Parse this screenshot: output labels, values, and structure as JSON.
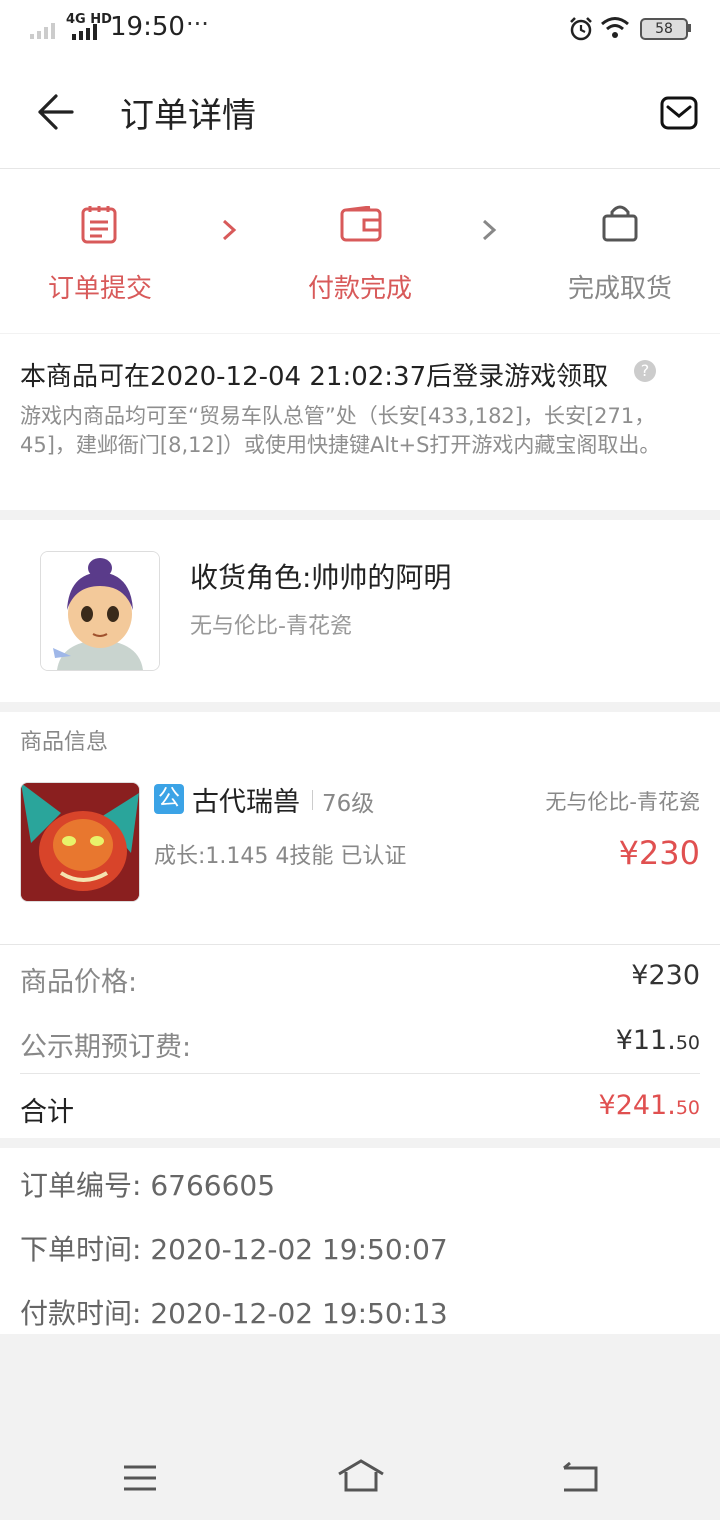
{
  "status_bar": {
    "network": "4G HD",
    "time": "19:50",
    "more": "···",
    "battery": "58"
  },
  "header": {
    "title": "订单详情"
  },
  "steps": [
    {
      "label": "订单提交",
      "color": "#d85a5a"
    },
    {
      "label": "付款完成",
      "color": "#d85a5a"
    },
    {
      "label": "完成取货",
      "color": "#888888"
    }
  ],
  "notice": {
    "title": "本商品可在2020-12-04 21:02:37后登录游戏领取",
    "help": "?",
    "description": "游戏内商品均可至“贸易车队总管”处（长安[433,182]，长安[271，45]，建邺衙门[8,12]）或使用快捷键Alt+S打开游戏内藏宝阁取出。"
  },
  "role": {
    "name": "收货角色:帅帅的阿明",
    "server": "无与伦比-青花瓷"
  },
  "goods": {
    "section_title": "商品信息",
    "badge": "公",
    "name": "古代瑞兽",
    "level": "76级",
    "server": "无与伦比-青花瓷",
    "desc": "成长:1.145 4技能 已认证",
    "price": "¥230"
  },
  "summary": {
    "price_label": "商品价格:",
    "price_value": "¥230",
    "fee_label": "公示期预订费:",
    "fee_main": "¥11.",
    "fee_cents": "50",
    "total_label": "合计",
    "total_main": "¥241.",
    "total_cents": "50"
  },
  "order": {
    "number_label": "订单编号:",
    "number": "6766605",
    "created_label": "下单时间:",
    "created": "2020-12-02 19:50:07",
    "paid_label": "付款时间:",
    "paid": "2020-12-02 19:50:13"
  },
  "colors": {
    "accent": "#e05050",
    "info_blue": "#3ba3e6"
  }
}
